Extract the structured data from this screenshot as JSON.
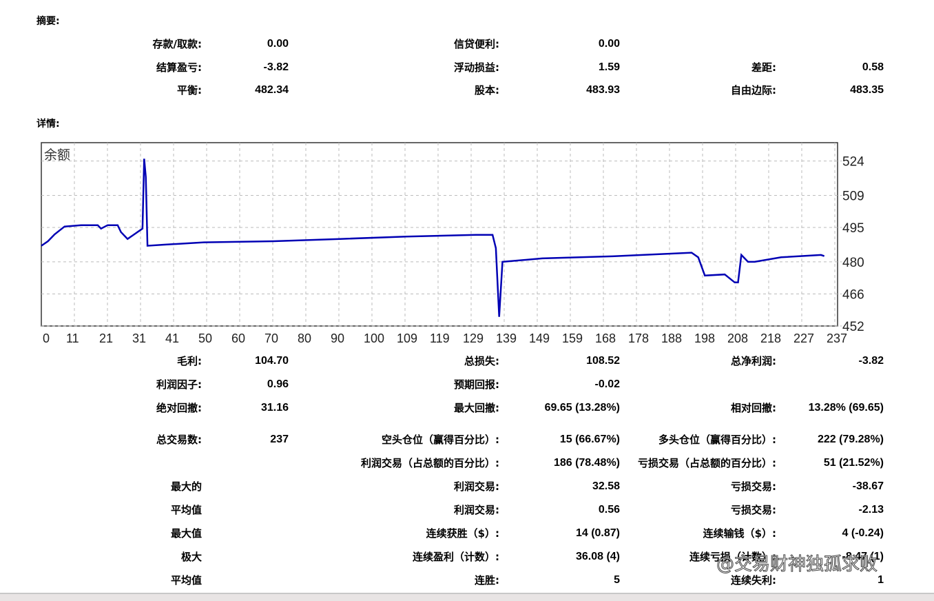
{
  "summary": {
    "title": "摘要:",
    "rows": [
      [
        "存款/取款:",
        "0.00",
        "信贷便利:",
        "0.00",
        null,
        null
      ],
      [
        "结算盈亏:",
        "-3.82",
        "浮动损益:",
        "1.59",
        "差距:",
        "0.58"
      ],
      [
        "平衡:",
        "482.34",
        "股本:",
        "483.93",
        "自由边际:",
        "483.35"
      ]
    ]
  },
  "details": {
    "title": "详情:",
    "rows": [
      [
        "毛利:",
        "104.70",
        "总损失:",
        "108.52",
        "总净利润:",
        "-3.82"
      ],
      [
        "利润因子:",
        "0.96",
        "预期回报:",
        "-0.02",
        null,
        null
      ],
      [
        "绝对回撤:",
        "31.16",
        "最大回撤:",
        "69.65 (13.28%)",
        "相对回撤:",
        "13.28% (69.65)"
      ],
      [
        "总交易数:",
        "237",
        "空头仓位（赢得百分比）:",
        "15 (66.67%)",
        "多头仓位（赢得百分比）:",
        "222 (79.28%)"
      ],
      [
        null,
        null,
        "利润交易（占总额的百分比）:",
        "186 (78.48%)",
        "亏损交易（占总额的百分比）:",
        "51 (21.52%)"
      ],
      [
        "最大的",
        null,
        "利润交易:",
        "32.58",
        "亏损交易:",
        "-38.67"
      ],
      [
        "平均值",
        null,
        "利润交易:",
        "0.56",
        "亏损交易:",
        "-2.13"
      ],
      [
        "最大值",
        null,
        "连续获胜（$）:",
        "14 (0.87)",
        "连续输钱（$）:",
        "4 (-0.24)"
      ],
      [
        "极大",
        null,
        "连续盈利（计数）:",
        "36.08 (4)",
        "连续亏损（计数）:",
        "-8.47 (1)"
      ],
      [
        "平均值",
        null,
        "连胜:",
        "5",
        "连续失利:",
        "1"
      ]
    ]
  },
  "watermark": "@交易财神独孤求败",
  "chart_data": {
    "type": "line",
    "title": "余额",
    "xlabel": "",
    "ylabel": "",
    "x_ticks": [
      0,
      11,
      21,
      31,
      41,
      50,
      60,
      70,
      80,
      90,
      100,
      109,
      119,
      129,
      139,
      149,
      159,
      168,
      178,
      188,
      198,
      208,
      218,
      227,
      237
    ],
    "y_ticks": [
      524,
      509,
      495,
      480,
      466,
      452
    ],
    "xlim": [
      0,
      240
    ],
    "ylim": [
      452,
      532
    ],
    "grid": true,
    "line_color": "#0000b4",
    "series": [
      {
        "points": [
          [
            0,
            487
          ],
          [
            2,
            489
          ],
          [
            4,
            492
          ],
          [
            7,
            495.4
          ],
          [
            12,
            496
          ],
          [
            17,
            496
          ],
          [
            18,
            494.5
          ],
          [
            20,
            496
          ],
          [
            23,
            496
          ],
          [
            24,
            493
          ],
          [
            26,
            490
          ],
          [
            28,
            492
          ],
          [
            30,
            494
          ],
          [
            30.5,
            494.5
          ],
          [
            31,
            525
          ],
          [
            31.5,
            517
          ],
          [
            32,
            487
          ],
          [
            37,
            487.5
          ],
          [
            49,
            488.5
          ],
          [
            70,
            489
          ],
          [
            90,
            490
          ],
          [
            110,
            491
          ],
          [
            131,
            491.8
          ],
          [
            136,
            491.8
          ],
          [
            137,
            486
          ],
          [
            138,
            456
          ],
          [
            138.5,
            468
          ],
          [
            139,
            480
          ],
          [
            151,
            481.5
          ],
          [
            172,
            482.4
          ],
          [
            196,
            484
          ],
          [
            198,
            482
          ],
          [
            200,
            474
          ],
          [
            206,
            474.5
          ],
          [
            209,
            471
          ],
          [
            210,
            471
          ],
          [
            211,
            483
          ],
          [
            213,
            480
          ],
          [
            215,
            480
          ],
          [
            223,
            482
          ],
          [
            235,
            483
          ],
          [
            236,
            482.5
          ]
        ]
      }
    ]
  }
}
